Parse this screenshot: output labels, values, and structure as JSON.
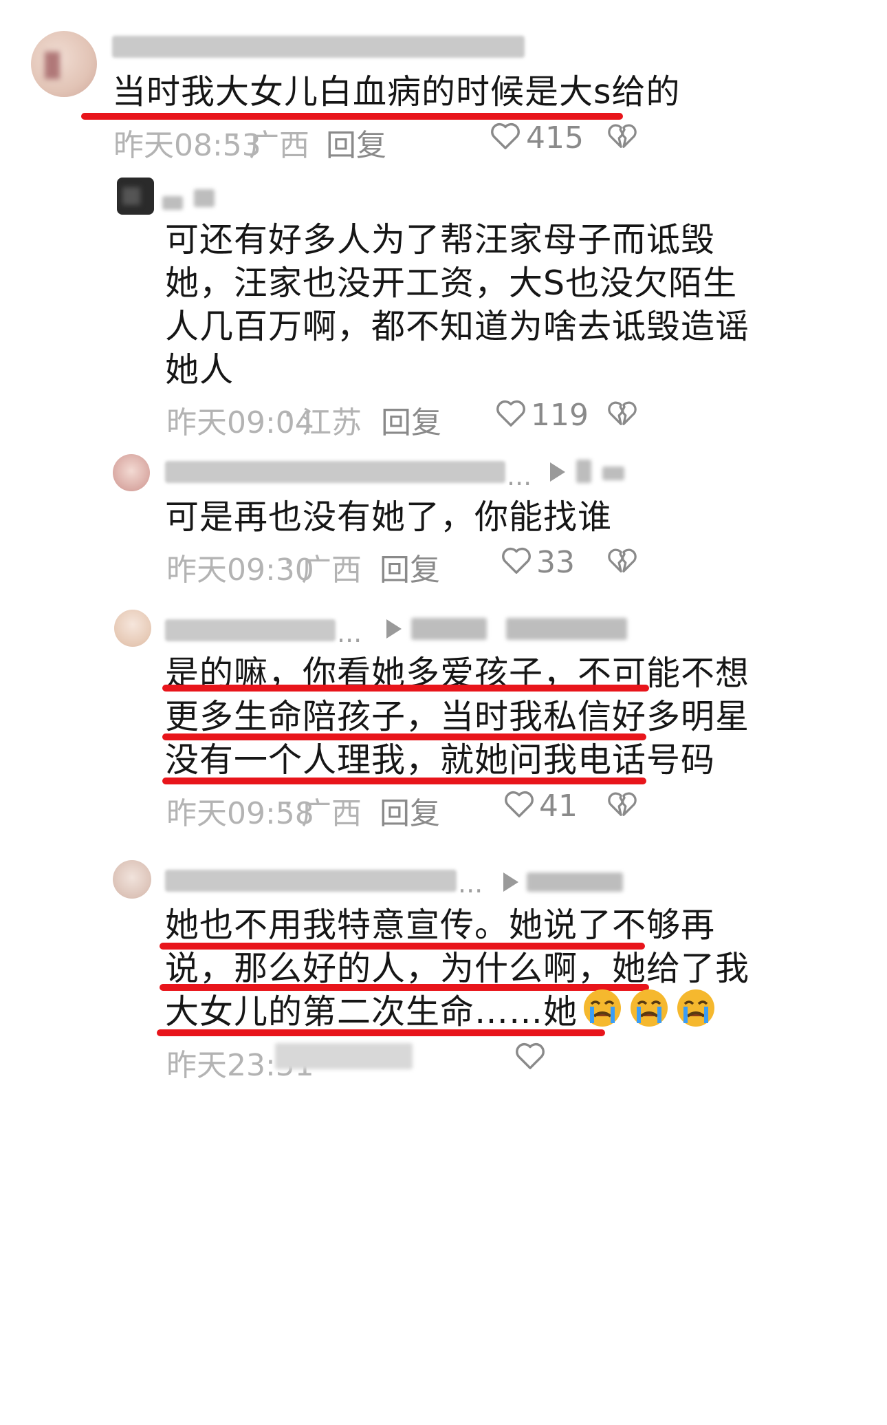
{
  "comments": [
    {
      "text_lines": [
        "当时我大女儿白血病的时候是大s给的"
      ],
      "time": "昨天08:53",
      "location": "广西",
      "reply_label": "回复",
      "likes": "415"
    },
    {
      "text_lines": [
        "可还有好多人为了帮汪家母子而诋毁",
        "她，汪家也没开工资，大S也没欠陌生",
        "人几百万啊，都不知道为啥去诋毁造谣",
        "她人"
      ],
      "time": "昨天09:04",
      "location": "江苏",
      "reply_label": "回复",
      "likes": "119"
    },
    {
      "text_lines": [
        "可是再也没有她了，你能找谁"
      ],
      "time": "昨天09:30",
      "location": "广西",
      "reply_label": "回复",
      "likes": "33"
    },
    {
      "text_lines": [
        "是的嘛，你看她多爱孩子，不可能不想",
        "更多生命陪孩子，当时我私信好多明星",
        "没有一个人理我，就她问我电话号码"
      ],
      "time": "昨天09:58",
      "location": "广西",
      "reply_label": "回复",
      "likes": "41"
    },
    {
      "text_lines": [
        "她也不用我特意宣传。她说了不够再",
        "说，那么好的人，为什么啊，她给了我",
        "大女儿的第二次生命……她"
      ],
      "time": "昨天23:51"
    }
  ],
  "colors": {
    "underline": "#e8151b",
    "meta_text": "#b3b3b3",
    "emoji": "#f5b82e"
  },
  "icons": {
    "like": "heart-outline-icon",
    "dislike": "broken-heart-icon",
    "reply_arrow": "play-arrow-icon",
    "emoji": "loudly-crying-face-emoji"
  }
}
